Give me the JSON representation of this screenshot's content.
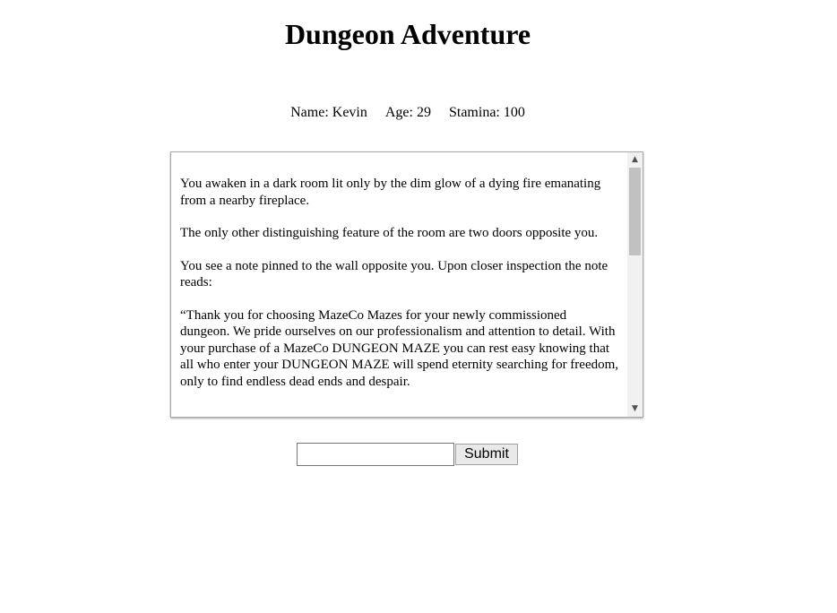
{
  "page": {
    "title": "Dungeon Adventure"
  },
  "stats": {
    "name": "Name: Kevin",
    "age": "Age: 29",
    "stamina": "Stamina: 100"
  },
  "story": {
    "paragraphs": [
      "You awaken in a dark room lit only by the dim glow of a dying fire emanating from a nearby fireplace.",
      "The only other distinguishing feature of the room are two doors opposite you.",
      "You see a note pinned to the wall opposite you. Upon closer inspection the note reads:",
      "“Thank you for choosing MazeCo Mazes for your newly commissioned dungeon. We pride ourselves on our professionalism and attention to detail. With your purchase of a MazeCo DUNGEON MAZE you can rest easy knowing that all who enter your DUNGEON MAZE will spend eternity searching for freedom, only to find endless dead ends and despair."
    ],
    "scrollbar": {
      "up_icon": "chevron-up-icon",
      "down_icon": "chevron-down-icon",
      "scroll_position": 0
    }
  },
  "form": {
    "input_value": "",
    "submit_label": "Submit"
  }
}
